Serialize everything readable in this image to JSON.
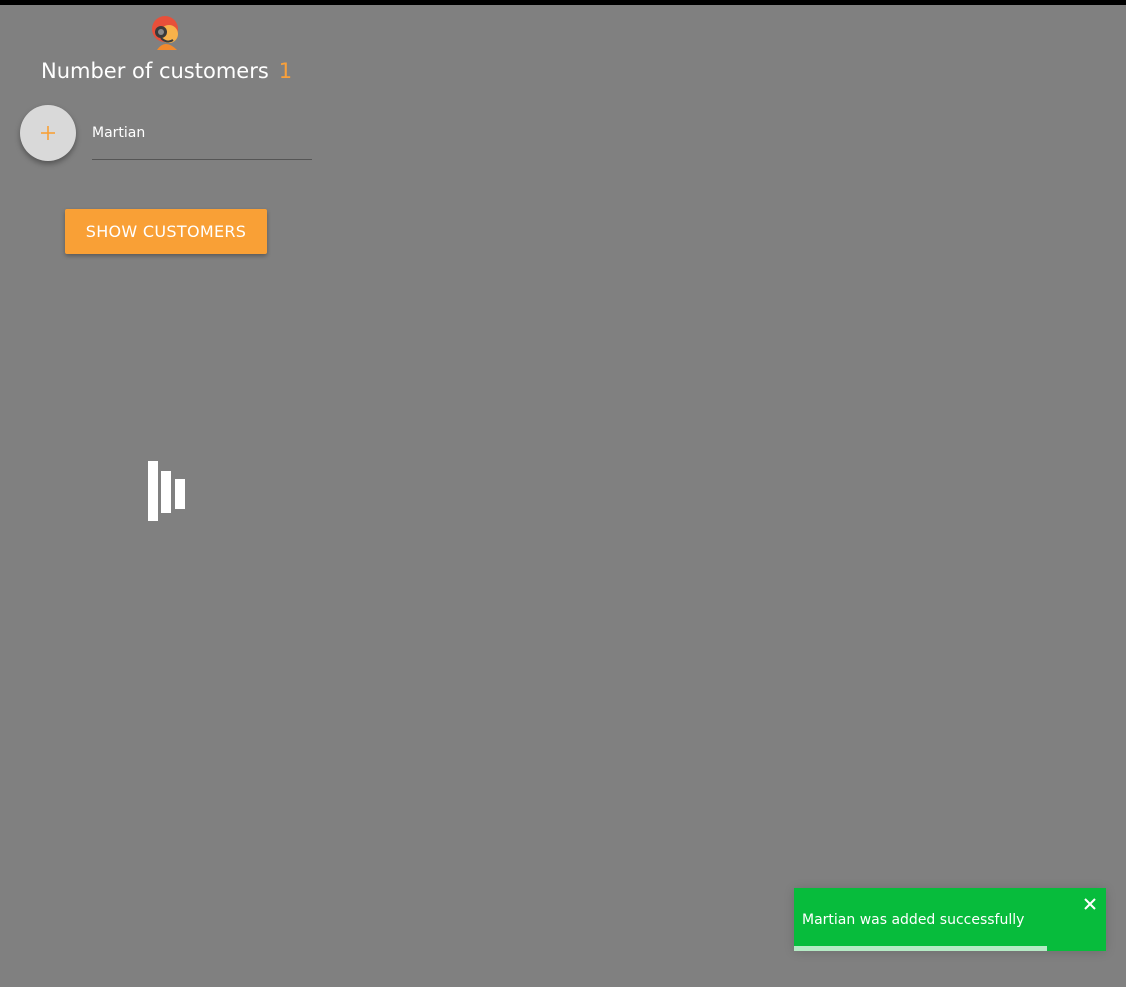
{
  "header": {
    "logo_icon": "support-agent-icon",
    "title": "Number of customers",
    "count": "1"
  },
  "form": {
    "add_icon": "plus-icon",
    "name_value": "Martian",
    "accent_color": "#f9a036"
  },
  "actions": {
    "show_customers_label": "Show customers"
  },
  "loader": {
    "icon": "loading-bars-icon"
  },
  "toast": {
    "message": "Martian was added successfully",
    "close_icon": "close-icon",
    "progress": 0.81,
    "color": "#07bc3c"
  }
}
